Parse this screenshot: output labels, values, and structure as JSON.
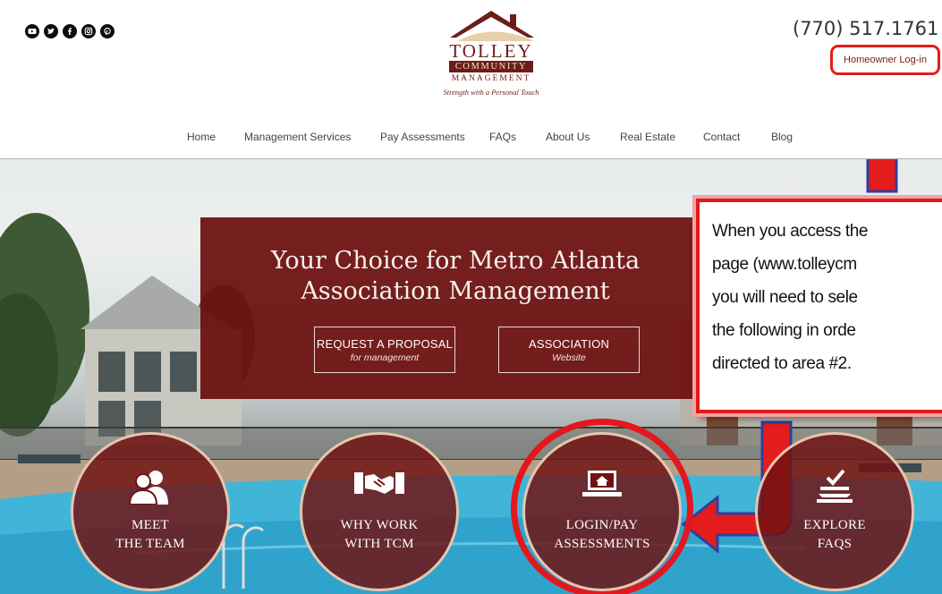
{
  "header": {
    "social_icons": [
      "youtube-icon",
      "twitter-icon",
      "facebook-icon",
      "instagram-icon",
      "pinterest-icon"
    ],
    "logo": {
      "name": "TOLLEY",
      "band": "COMMUNITY",
      "sub": "MANAGEMENT",
      "tagline": "Strength with a Personal Touch"
    },
    "phone": "(770) 517.1761",
    "homeowner_login": "Homeowner Log-in",
    "nav": [
      "Home",
      "Management Services",
      "Pay Assessments",
      "FAQs",
      "About Us",
      "Real Estate",
      "Contact",
      "Blog"
    ]
  },
  "hero": {
    "headline_1": "Your Choice for Metro Atlanta",
    "headline_2": "Association Management",
    "buttons": [
      {
        "label": "REQUEST A PROPOSAL",
        "sub": "for management"
      },
      {
        "label": "ASSOCIATION",
        "sub": "Website"
      }
    ],
    "circles": [
      {
        "line1": "MEET",
        "line2": "THE TEAM",
        "icon": "team-icon"
      },
      {
        "line1": "WHY WORK",
        "line2": "WITH TCM",
        "icon": "handshake-icon"
      },
      {
        "line1": "LOGIN/PAY",
        "line2": "ASSESSMENTS",
        "icon": "laptop-home-icon"
      },
      {
        "line1": "EXPLORE",
        "line2": "FAQS",
        "icon": "checklist-icon"
      }
    ]
  },
  "callout": {
    "lines": [
      "When you access the",
      "page (www.tolleycm",
      "you will need to sele",
      "the following in orde",
      "directed to area #2."
    ]
  },
  "colors": {
    "brand_maroon": "#6e1c1a",
    "annotation_red": "#e31c1c",
    "arrow_blue": "#2e3f9e"
  }
}
